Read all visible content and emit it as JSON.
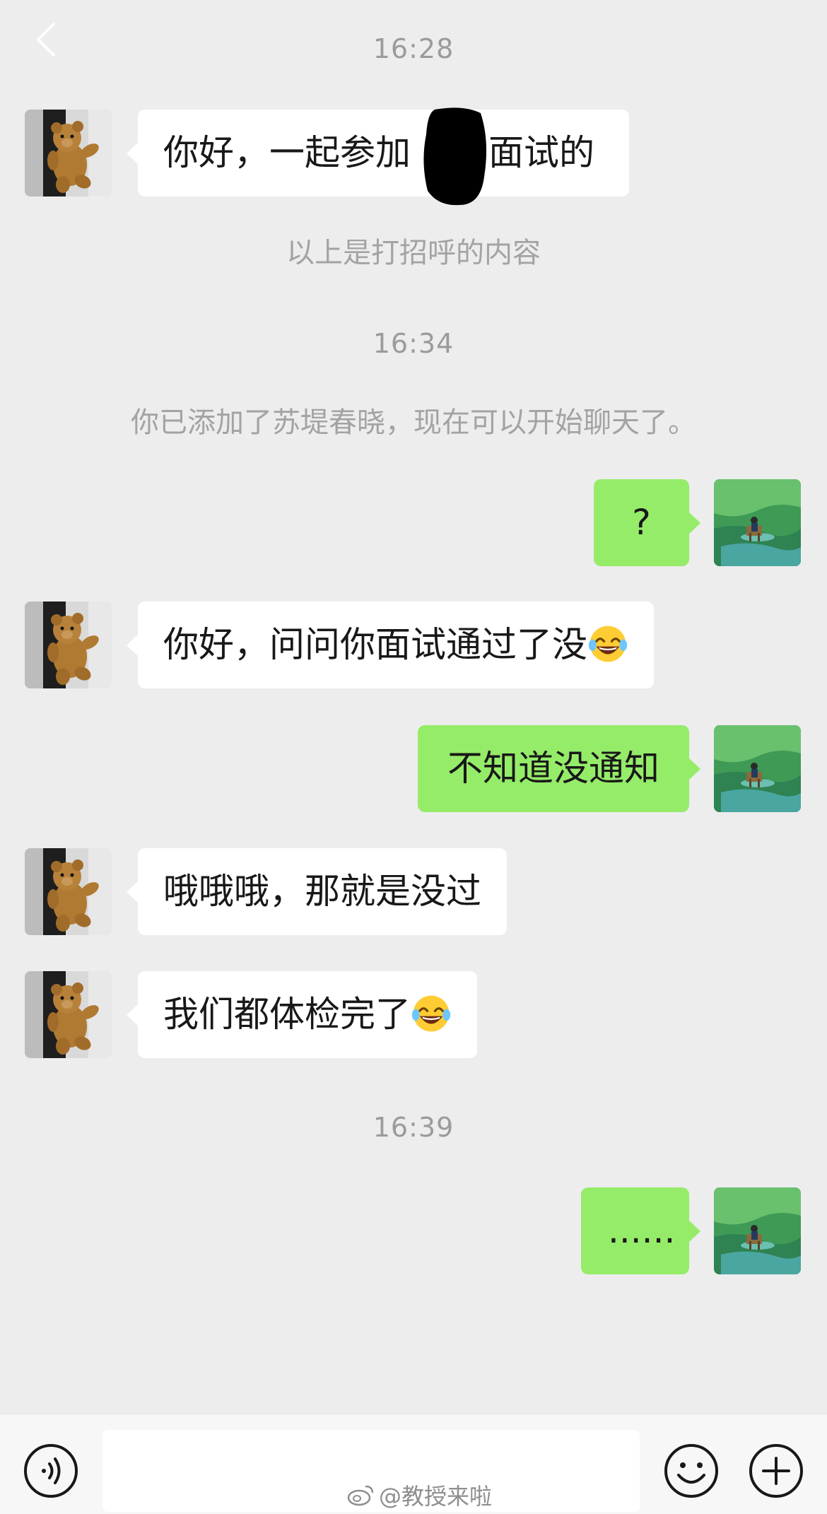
{
  "chat": {
    "time_1": "16:28",
    "msg_1_part_a": "你好，一起参加",
    "msg_1_part_b": "面试的",
    "greeting_note": "以上是打招呼的内容",
    "time_2": "16:34",
    "added_note": "你已添加了苏堤春晓，现在可以开始聊天了。",
    "msg_2": "?",
    "msg_3": "你好，问问你面试通过了没",
    "msg_4": "不知道没通知",
    "msg_5": "哦哦哦，那就是没过",
    "msg_6": "我们都体检完了",
    "time_3": "16:39",
    "msg_7": "......"
  },
  "watermark": {
    "text": "@教授来啦"
  },
  "icons": {
    "back": "chevron-left-icon",
    "voice": "voice-icon",
    "emoji": "emoji-icon",
    "plus": "plus-icon",
    "laugh": "tears-of-joy-emoji"
  },
  "colors": {
    "background": "#ededed",
    "incoming_bubble": "#ffffff",
    "outgoing_bubble": "#95ec69",
    "meta_text": "#9b9b9b"
  }
}
